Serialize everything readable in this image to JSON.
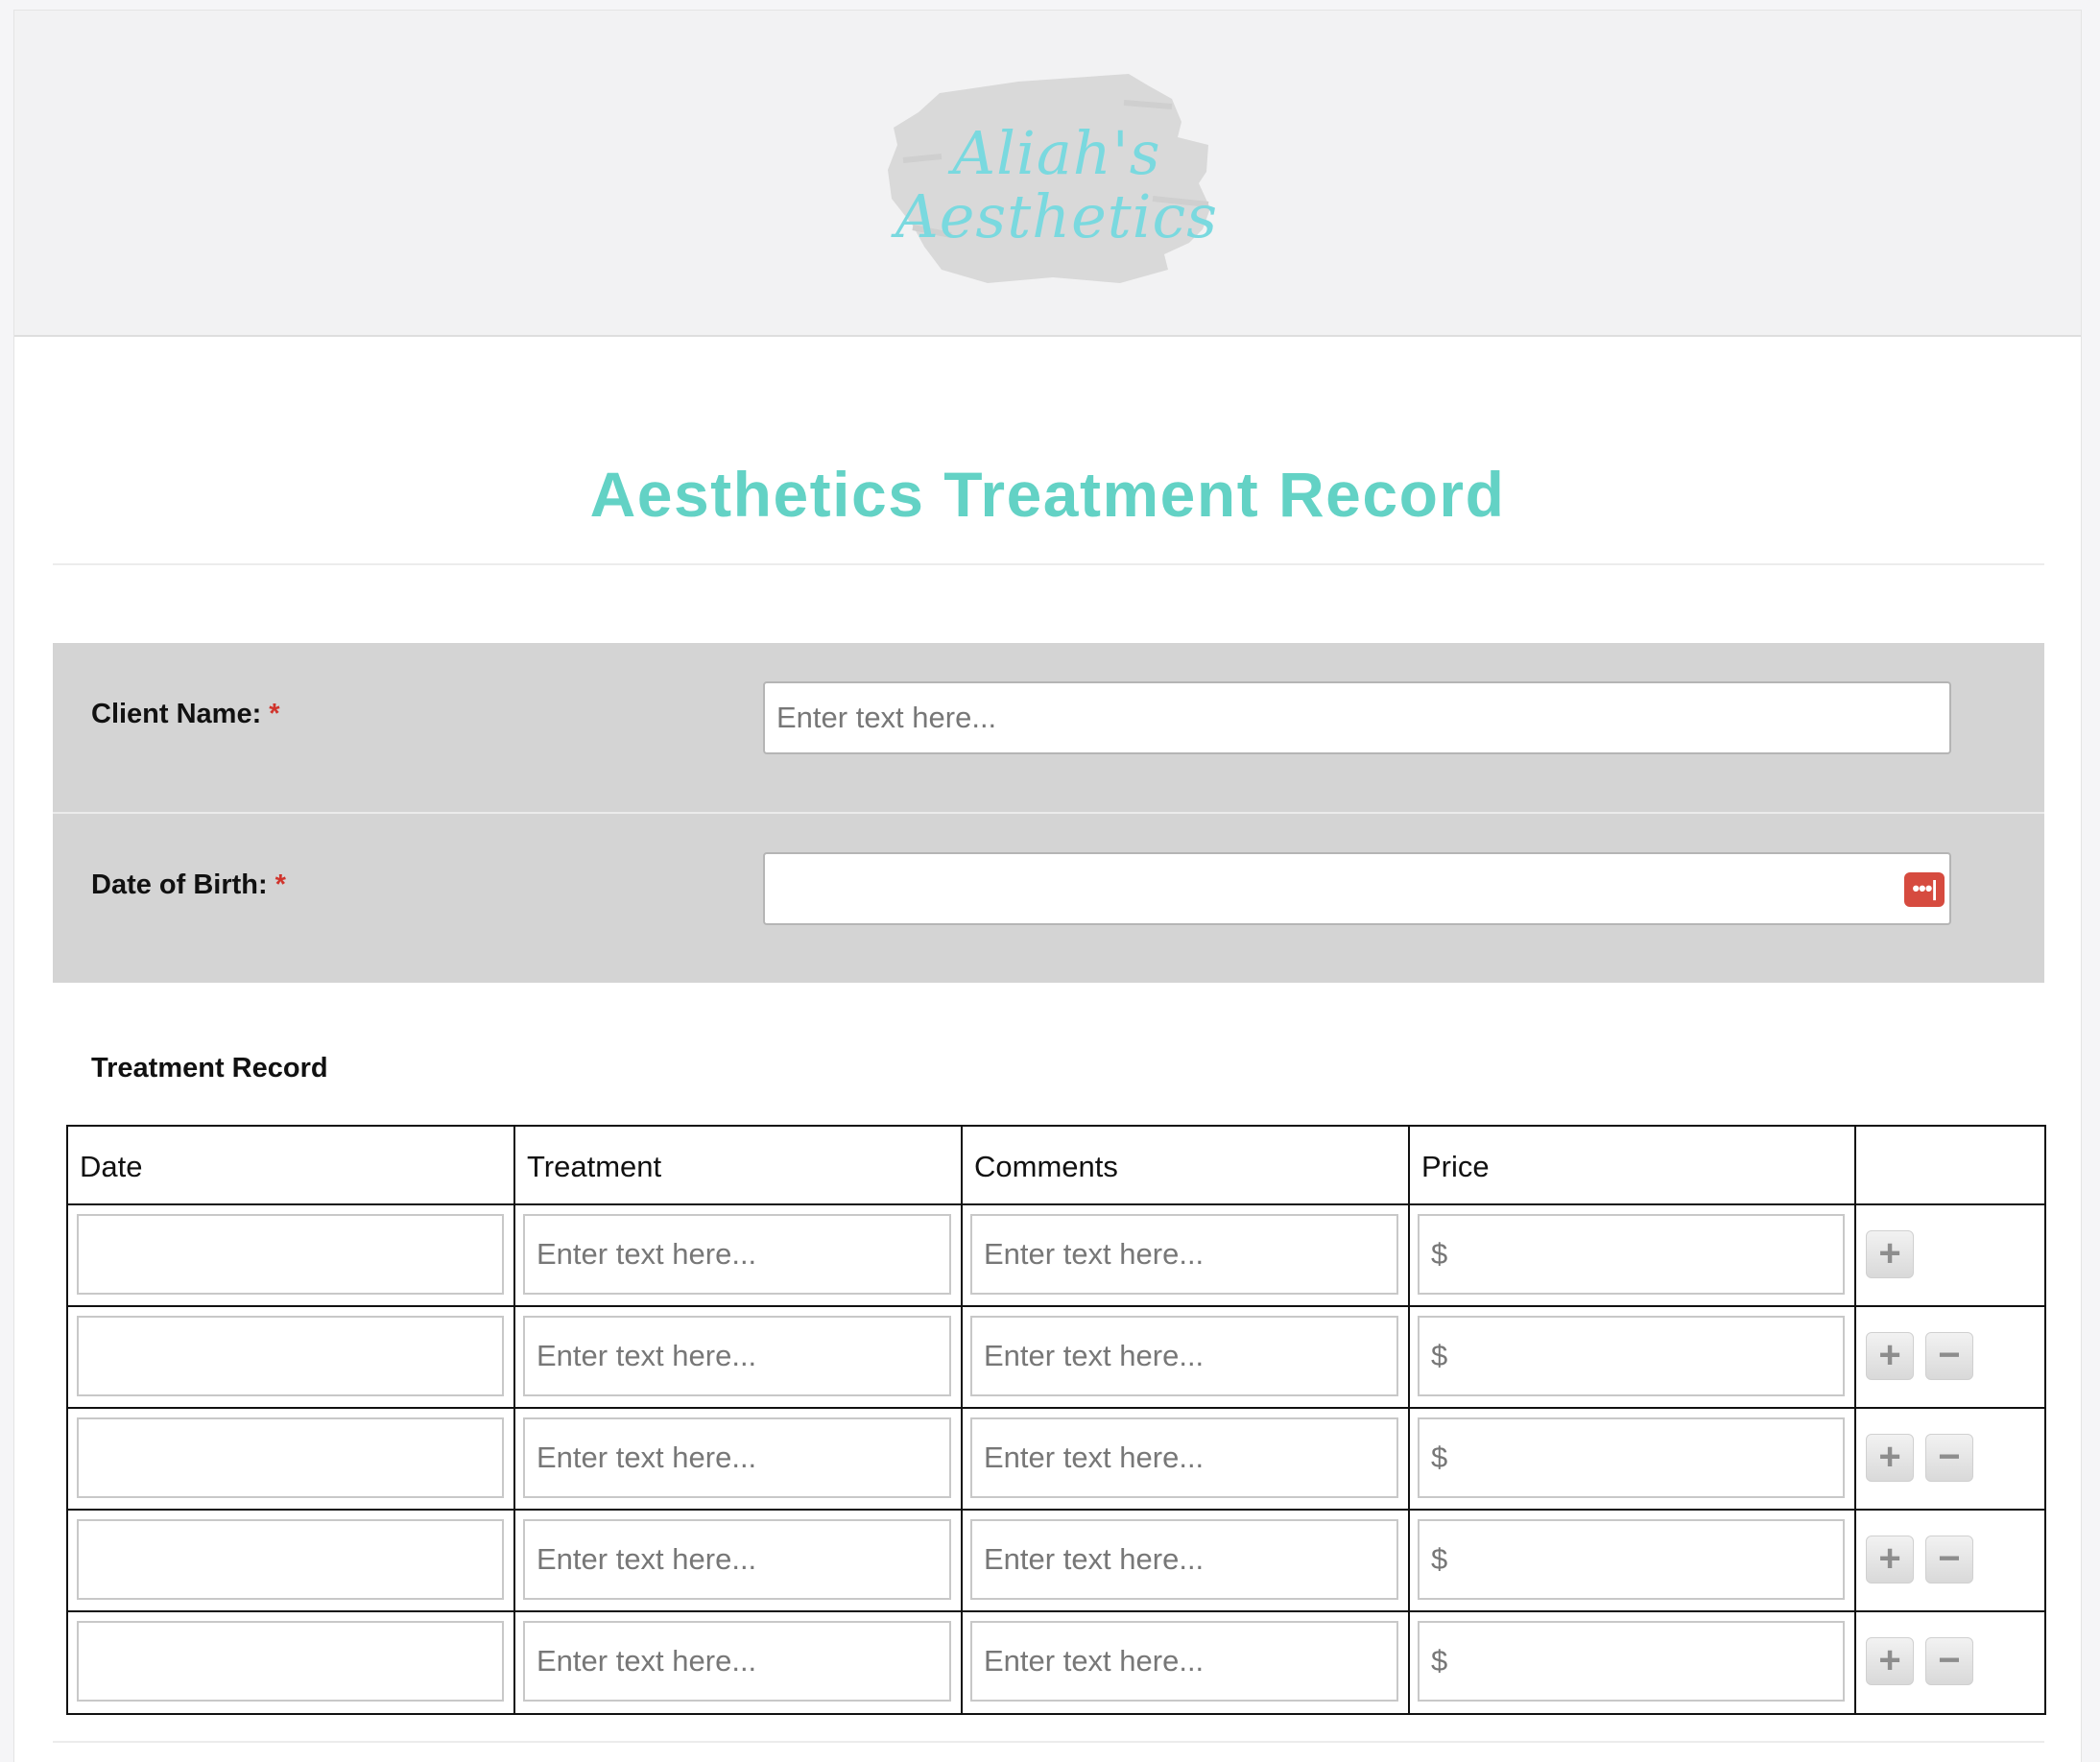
{
  "logo": {
    "line1": "Aliah's",
    "line2": "Aesthetics"
  },
  "form": {
    "title": "Aesthetics Treatment Record",
    "required_marker": "*",
    "client_name": {
      "label": "Client Name:",
      "placeholder": "Enter text here..."
    },
    "date_of_birth": {
      "label": "Date of Birth:",
      "value": "",
      "picker_icon": "ellipsis-calendar-icon",
      "picker_label": "•••|"
    }
  },
  "treatment": {
    "section_label": "Treatment Record",
    "columns": [
      "Date",
      "Treatment",
      "Comments",
      "Price",
      ""
    ],
    "text_placeholder": "Enter text here...",
    "price_prefix": "$",
    "add_label": "+",
    "remove_label": "−",
    "rows": [
      {
        "date": "",
        "treatment": "",
        "comments": "",
        "price": "",
        "can_remove": false
      },
      {
        "date": "",
        "treatment": "",
        "comments": "",
        "price": "",
        "can_remove": true
      },
      {
        "date": "",
        "treatment": "",
        "comments": "",
        "price": "",
        "can_remove": true
      },
      {
        "date": "",
        "treatment": "",
        "comments": "",
        "price": "",
        "can_remove": true
      },
      {
        "date": "",
        "treatment": "",
        "comments": "",
        "price": "",
        "can_remove": true
      }
    ]
  },
  "colors": {
    "accent": "#63d2c5",
    "logo_text": "#7ad9df",
    "required": "#d0342c",
    "date_picker": "#d64b3f",
    "field_band": "#d4d4d4"
  }
}
